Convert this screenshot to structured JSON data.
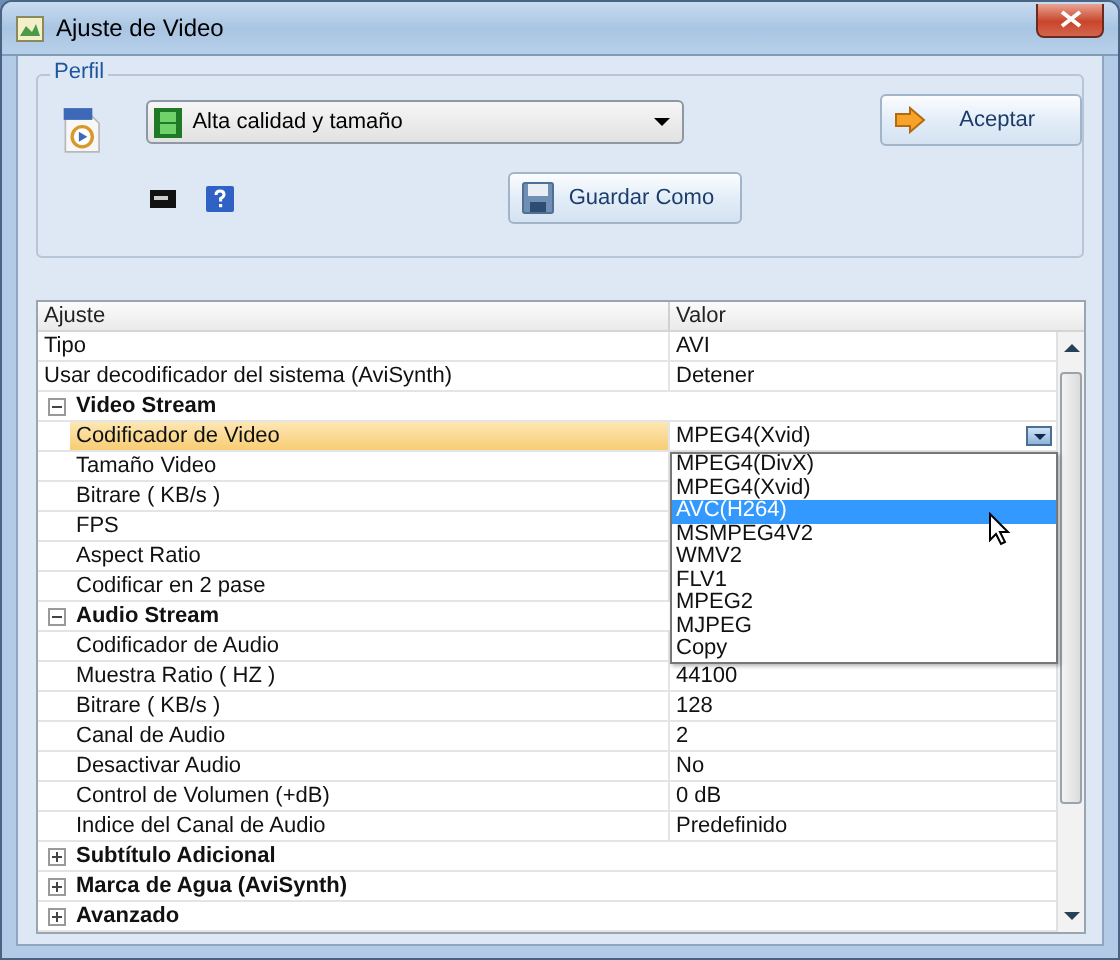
{
  "window": {
    "title": "Ajuste de Video"
  },
  "profile": {
    "group_label": "Perfil",
    "preset": "Alta calidad y tamaño",
    "accept_button": "Aceptar",
    "save_as_button": "Guardar Como"
  },
  "grid": {
    "columns": [
      "Ajuste",
      "Valor"
    ],
    "rows": [
      {
        "kind": "property",
        "name": "Tipo",
        "value": "AVI",
        "selected": false
      },
      {
        "kind": "property",
        "name": "Usar decodificador del sistema (AviSynth)",
        "value": "Detener",
        "selected": false
      },
      {
        "kind": "category",
        "name": "Video Stream",
        "expanded": true,
        "children": [
          {
            "kind": "property",
            "name": "Codificador de Video",
            "value": "MPEG4(Xvid)",
            "selected": true,
            "options": [
              {
                "label": "MPEG4(DivX)",
                "highlighted": false
              },
              {
                "label": "MPEG4(Xvid)",
                "highlighted": false
              },
              {
                "label": "AVC(H264)",
                "highlighted": true
              },
              {
                "label": "MSMPEG4V2",
                "highlighted": false
              },
              {
                "label": "WMV2",
                "highlighted": false
              },
              {
                "label": "FLV1",
                "highlighted": false
              },
              {
                "label": "MPEG2",
                "highlighted": false
              },
              {
                "label": "MJPEG",
                "highlighted": false
              },
              {
                "label": "Copy",
                "highlighted": false
              }
            ]
          },
          {
            "kind": "property",
            "name": "Tamaño Video",
            "selected": false
          },
          {
            "kind": "property",
            "name": "Bitrare ( KB/s )",
            "selected": false
          },
          {
            "kind": "property",
            "name": "FPS",
            "selected": false
          },
          {
            "kind": "property",
            "name": "Aspect Ratio",
            "selected": false
          },
          {
            "kind": "property",
            "name": "Codificar en 2 pase",
            "selected": false
          }
        ]
      },
      {
        "kind": "category",
        "name": "Audio Stream",
        "expanded": true,
        "children": [
          {
            "kind": "property",
            "name": "Codificador de Audio",
            "selected": false
          },
          {
            "kind": "property",
            "name": "Muestra Ratio ( HZ )",
            "value": "44100",
            "selected": false
          },
          {
            "kind": "property",
            "name": "Bitrare ( KB/s )",
            "value": "128",
            "selected": false
          },
          {
            "kind": "property",
            "name": "Canal de Audio",
            "value": "2",
            "selected": false
          },
          {
            "kind": "property",
            "name": "Desactivar Audio",
            "value": "No",
            "selected": false
          },
          {
            "kind": "property",
            "name": "Control de Volumen (+dB)",
            "value": "0 dB",
            "selected": false
          },
          {
            "kind": "property",
            "name": "Indice del Canal de Audio",
            "value": "Predefinido",
            "selected": false
          }
        ]
      },
      {
        "kind": "category",
        "name": "Subtítulo Adicional",
        "expanded": false
      },
      {
        "kind": "category",
        "name": "Marca de Agua (AviSynth)",
        "expanded": false
      },
      {
        "kind": "category",
        "name": "Avanzado",
        "expanded": false
      }
    ]
  }
}
